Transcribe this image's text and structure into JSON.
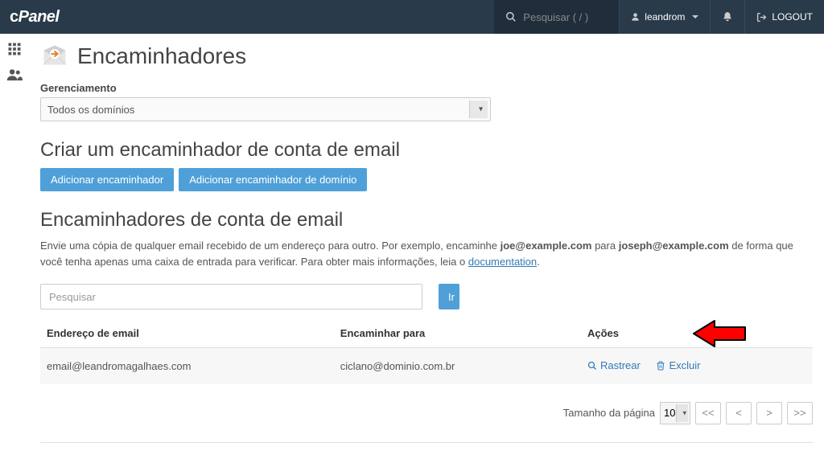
{
  "topbar": {
    "logo_prefix": "c",
    "logo_suffix": "Panel",
    "search_placeholder": "Pesquisar ( / )",
    "username": "leandrom",
    "logout_label": "LOGOUT"
  },
  "page": {
    "title": "Encaminhadores"
  },
  "management": {
    "label": "Gerenciamento",
    "selected": "Todos os domínios"
  },
  "create": {
    "heading": "Criar um encaminhador de conta de email",
    "add_forwarder": "Adicionar encaminhador",
    "add_domain_forwarder": "Adicionar encaminhador de domínio"
  },
  "list": {
    "heading": "Encaminhadores de conta de email",
    "desc_1": "Envie uma cópia de qualquer email recebido de um endereço para outro. Por exemplo, encaminhe ",
    "desc_ex1": "joe@example.com",
    "desc_2": " para ",
    "desc_ex2": "joseph@example.com",
    "desc_3": " de forma que você tenha apenas uma caixa de entrada para verificar. Para obter mais informações, leia o ",
    "doc_label": "documentation",
    "search_placeholder": "Pesquisar",
    "go_label": "Ir",
    "columns": {
      "email": "Endereço de email",
      "forward_to": "Encaminhar para",
      "actions": "Ações"
    },
    "rows": [
      {
        "email": "email@leandromagalhaes.com",
        "forward_to": "ciclano@dominio.com.br"
      }
    ],
    "action_trace": "Rastrear",
    "action_delete": "Excluir"
  },
  "pager": {
    "size_label": "Tamanho da página",
    "size_value": "10",
    "first": "<<",
    "prev": "<",
    "next": ">",
    "last": ">>"
  }
}
